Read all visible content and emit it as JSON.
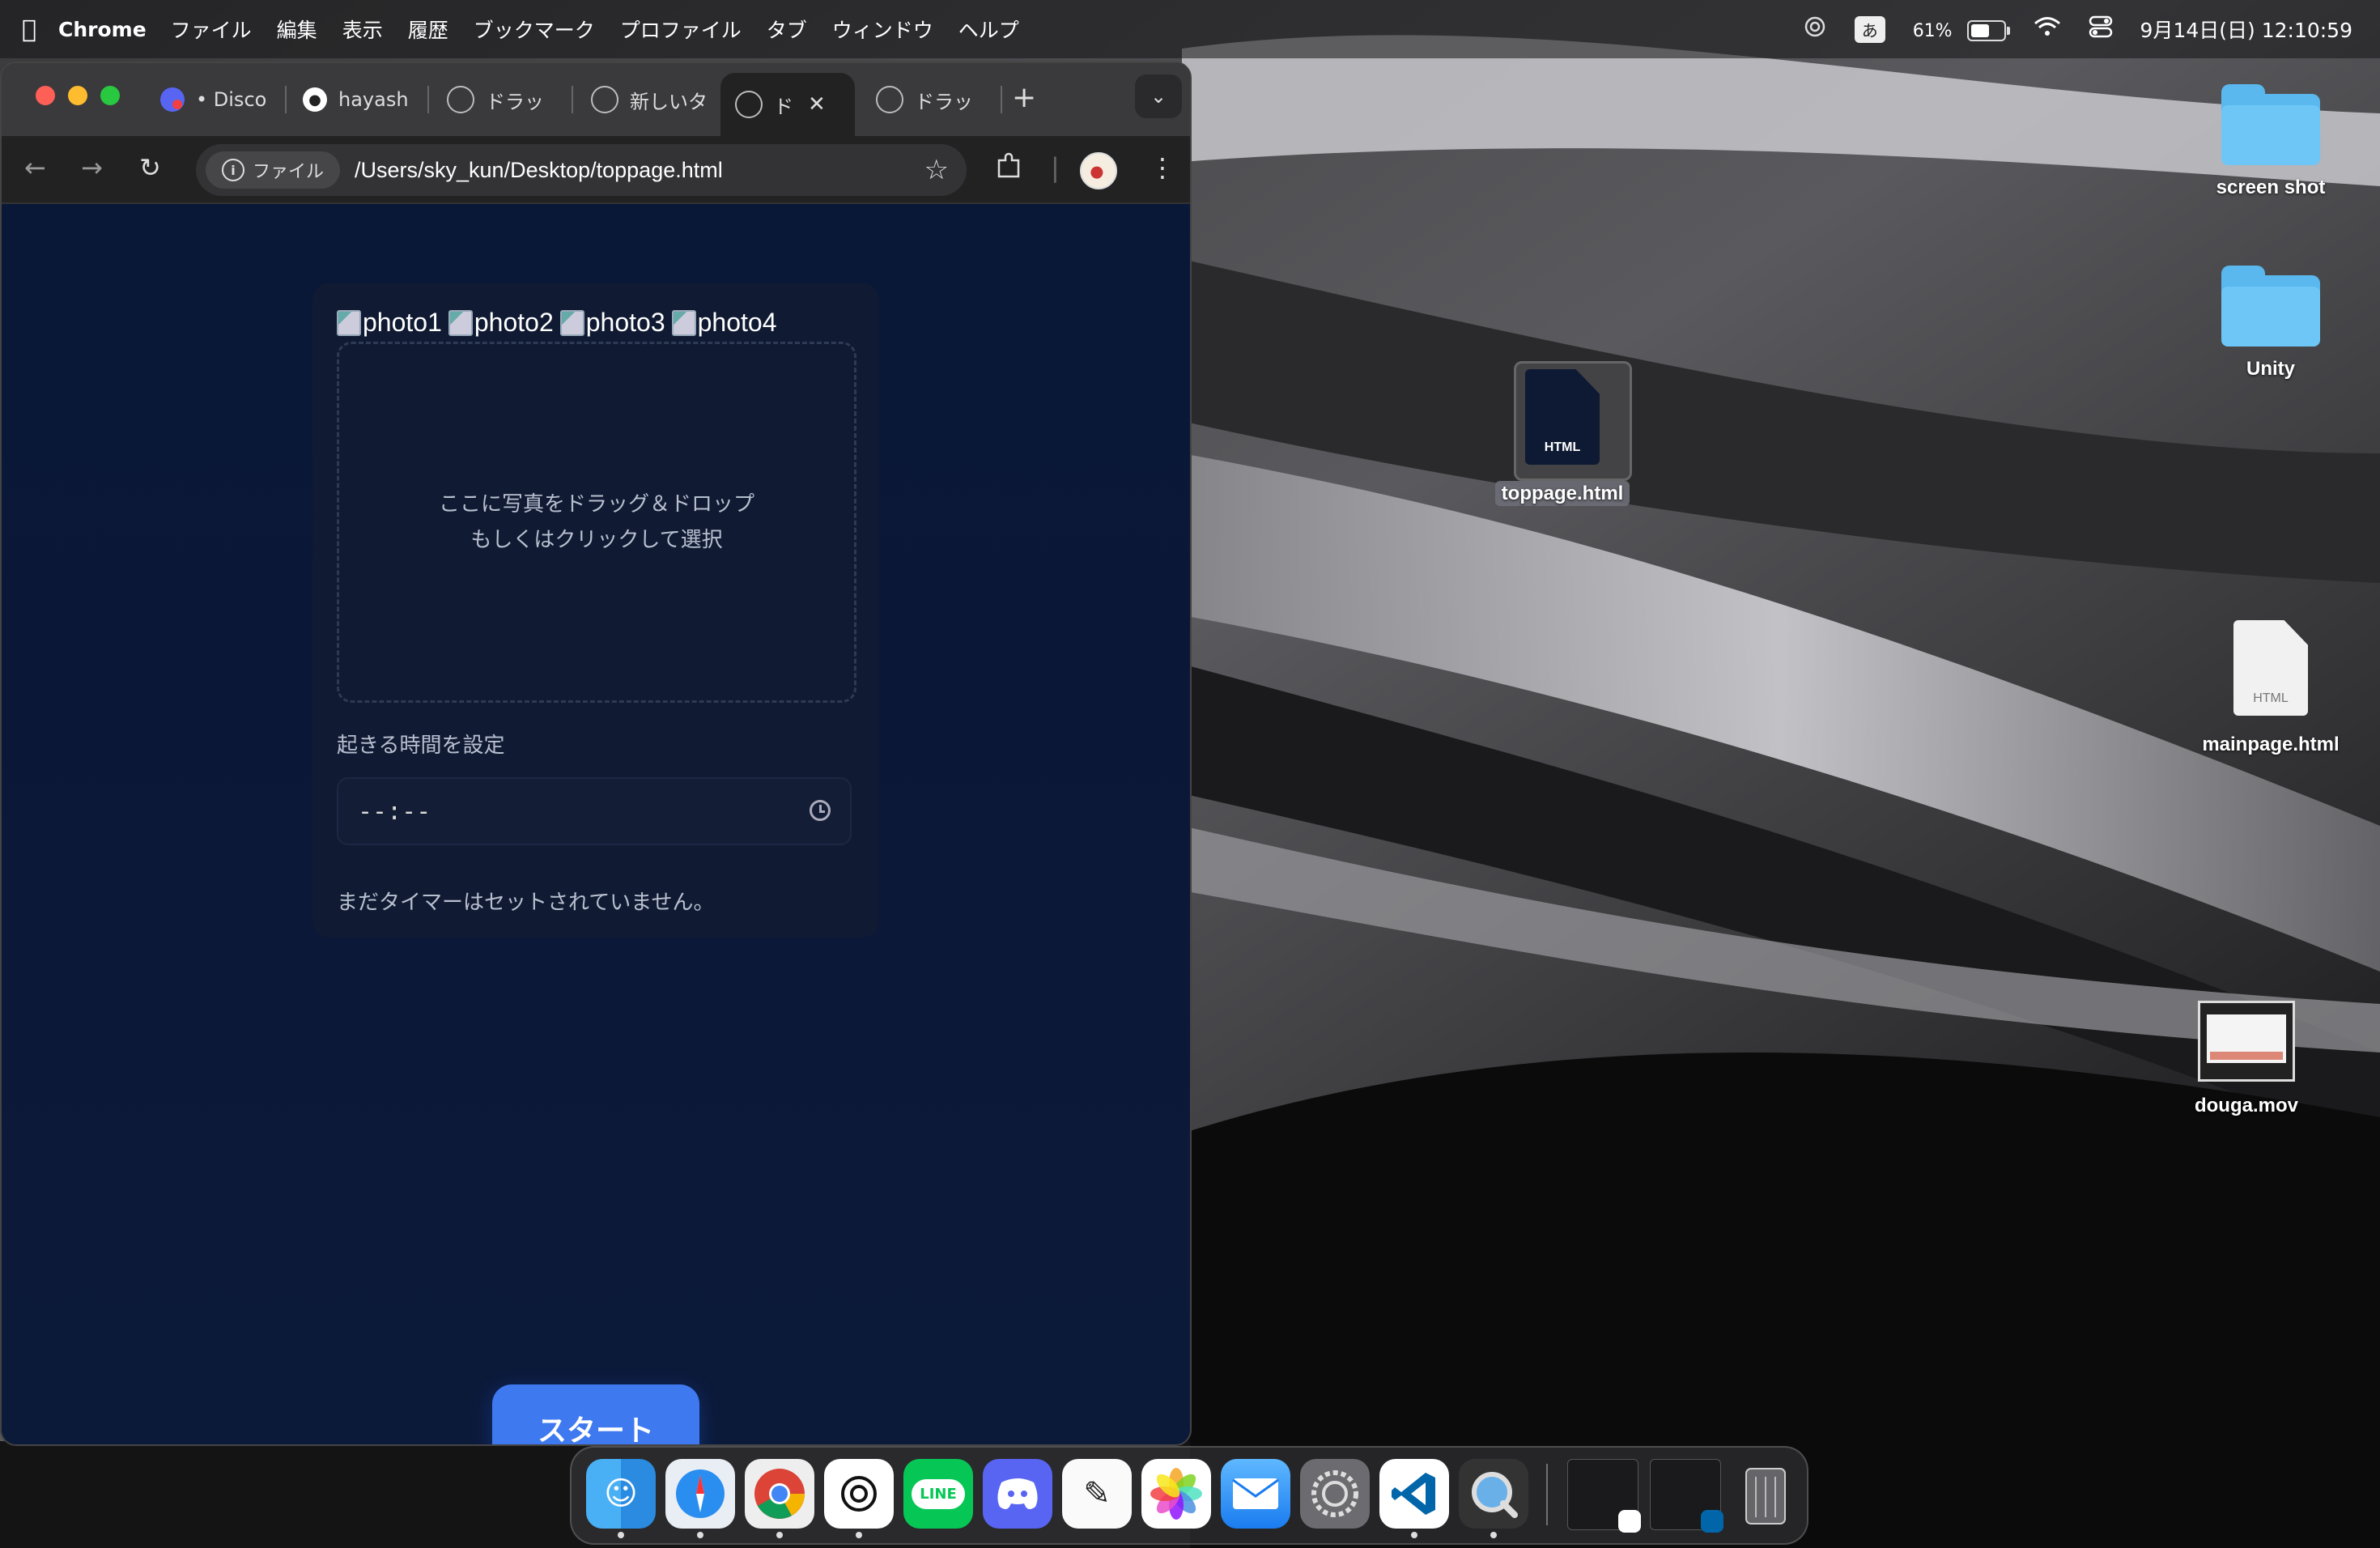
{
  "menubar": {
    "app_name": "Chrome",
    "items": [
      "ファイル",
      "編集",
      "表示",
      "履歴",
      "ブックマーク",
      "プロファイル",
      "タブ",
      "ウィンドウ",
      "ヘルプ"
    ],
    "ime": "あ",
    "battery_percent": "61%",
    "battery_level": 0.61,
    "datetime": "9月14日(日) 12:10:59"
  },
  "browser": {
    "tabs": [
      {
        "label": "• Disco",
        "icon": "discord-icon",
        "active": false
      },
      {
        "label": "hayash",
        "icon": "github-icon",
        "active": false
      },
      {
        "label": "ドラッ",
        "icon": "globe-icon",
        "active": false
      },
      {
        "label": "新しいタ",
        "icon": "chatgpt-icon",
        "active": false
      },
      {
        "label": "ド",
        "icon": "globe-icon",
        "active": true
      },
      {
        "label": "ドラッ",
        "icon": "globe-icon",
        "active": false
      }
    ],
    "omnibox": {
      "chip_label": "ファイル",
      "url": "/Users/sky_kun/Desktop/toppage.html"
    }
  },
  "page": {
    "photo_alts": [
      "photo1",
      "photo2",
      "photo3",
      "photo4"
    ],
    "dropzone_line1": "ここに写真をドラッグ＆ドロップ",
    "dropzone_line2": "もしくはクリックして選択",
    "time_label": "起きる時間を設定",
    "time_value": "--:--",
    "status": "まだタイマーはセットされていません。",
    "start_button": "スタート"
  },
  "desktop": {
    "icons": [
      {
        "label": "screen shot",
        "type": "folder"
      },
      {
        "label": "Unity",
        "type": "folder"
      },
      {
        "label": "toppage.html",
        "type": "html-document",
        "ext": "HTML",
        "selected": true
      },
      {
        "label": "mainpage.html",
        "type": "html-document",
        "ext": "HTML"
      },
      {
        "label": "douga.mov",
        "type": "video"
      }
    ]
  },
  "dock": {
    "apps": [
      "finder-icon",
      "safari-icon",
      "chrome-icon",
      "chatgpt-icon",
      "line-icon",
      "discord-icon",
      "freeform-icon",
      "photos-icon",
      "mail-icon",
      "system-settings-icon",
      "vscode-icon",
      "quicktime-icon"
    ],
    "line_label": "LINE",
    "recent": [
      "chatgpt-window-thumbnail",
      "vscode-window-thumbnail"
    ],
    "trash": "trash-icon"
  },
  "colors": {
    "accent": "#3f79f0",
    "folder": "#5ab8ef",
    "page_bg": "#0a1838",
    "card_bg": "#101a32"
  }
}
